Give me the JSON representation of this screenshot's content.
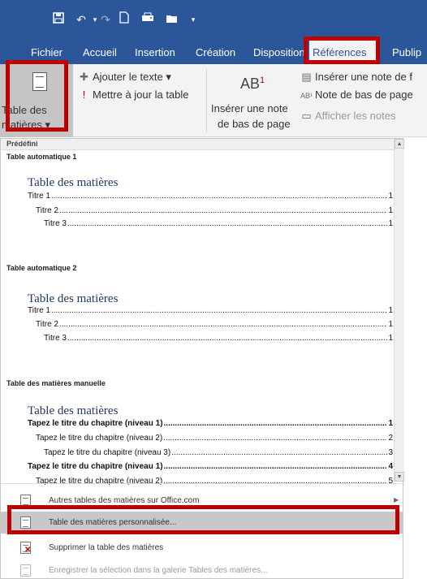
{
  "quick_access": {
    "icons": [
      "save-icon",
      "undo-icon",
      "redo-icon",
      "new-doc-icon",
      "print-preview-icon",
      "open-icon",
      "customize-icon"
    ]
  },
  "tabs": [
    {
      "label": "Fichier",
      "active": false
    },
    {
      "label": "Accueil",
      "active": false
    },
    {
      "label": "Insertion",
      "active": false
    },
    {
      "label": "Création",
      "active": false
    },
    {
      "label": "Disposition",
      "active": false
    },
    {
      "label": "Références",
      "active": true
    },
    {
      "label": "Publip",
      "active": false
    }
  ],
  "ribbon": {
    "toc_button": {
      "line1": "Table des",
      "line2": "matières ▾"
    },
    "add_text": "Ajouter le texte ▾",
    "update_table": "Mettre à jour la table",
    "footnote_icon": {
      "base": "AB",
      "sup": "1"
    },
    "insert_footnote_line1": "Insérer une note",
    "insert_footnote_line2": "de bas de page",
    "insert_endnote": "Insérer une note de f",
    "next_footnote": "Note de bas de page",
    "show_notes": "Afficher les notes"
  },
  "gallery": {
    "header": "Prédéfini",
    "sections": [
      {
        "title": "Table automatique 1",
        "heading": "Table des matières",
        "lines": [
          {
            "text": "Titre 1",
            "page": "1",
            "level": 1,
            "bold": false
          },
          {
            "text": "Titre 2",
            "page": "1",
            "level": 2,
            "bold": false
          },
          {
            "text": "Titre 3",
            "page": "1",
            "level": 3,
            "bold": false
          }
        ]
      },
      {
        "title": "Table automatique 2",
        "heading": "Table des matières",
        "lines": [
          {
            "text": "Titre 1",
            "page": "1",
            "level": 1,
            "bold": false
          },
          {
            "text": "Titre 2",
            "page": "1",
            "level": 2,
            "bold": false
          },
          {
            "text": "Titre 3",
            "page": "1",
            "level": 3,
            "bold": false
          }
        ]
      },
      {
        "title": "Table des matières manuelle",
        "heading": "Table des matières",
        "lines": [
          {
            "text": "Tapez le titre du chapitre (niveau 1)",
            "page": "1",
            "level": 1,
            "bold": true
          },
          {
            "text": "Tapez le titre du chapitre (niveau 2)",
            "page": "2",
            "level": 2,
            "bold": false
          },
          {
            "text": "Tapez le titre du chapitre (niveau 3)",
            "page": "3",
            "level": 3,
            "bold": false
          },
          {
            "text": "Tapez le titre du chapitre (niveau 1)",
            "page": "4",
            "level": 1,
            "bold": true
          },
          {
            "text": "Tapez le titre du chapitre (niveau 2)",
            "page": "5",
            "level": 2,
            "bold": false
          }
        ]
      }
    ],
    "menu": [
      {
        "label": "Autres tables des matières sur Office.com",
        "state": "normal",
        "submenu": true
      },
      {
        "label": "Table des matières personnalisée...",
        "state": "selected",
        "submenu": false
      },
      {
        "label": "Supprimer la table des matières",
        "state": "normal",
        "submenu": false
      },
      {
        "label": "Enregistrer la sélection dans la galerie Tables des matières...",
        "state": "disabled",
        "submenu": false
      }
    ]
  },
  "colors": {
    "ribbon_blue": "#2b579a",
    "highlight_red": "#c00000",
    "toc_heading": "#1f3864"
  }
}
